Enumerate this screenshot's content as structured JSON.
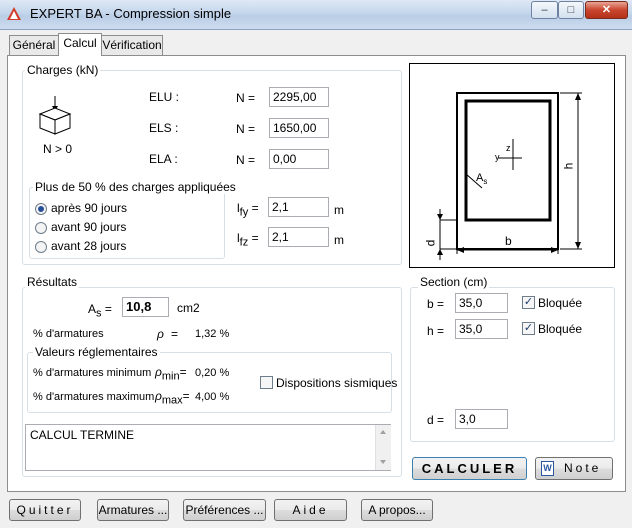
{
  "window": {
    "title": "EXPERT BA - Compression simple",
    "min": "–",
    "max": "□",
    "close": "✕"
  },
  "tabs": [
    {
      "label": "Général"
    },
    {
      "label": "Calcul"
    },
    {
      "label": "Vérification"
    }
  ],
  "charges": {
    "title": "Charges (kN)",
    "icon_caption": "N > 0",
    "rows": [
      {
        "state": "ELU :",
        "n_label": "N =",
        "value": "2295,00"
      },
      {
        "state": "ELS :",
        "n_label": "N =",
        "value": "1650,00"
      },
      {
        "state": "ELA :",
        "n_label": "N =",
        "value": "0,00"
      }
    ],
    "applied": {
      "title": "Plus de 50 % des charges appliquées",
      "options": [
        {
          "label": "après 90 jours",
          "selected": true
        },
        {
          "label": "avant 90 jours",
          "selected": false
        },
        {
          "label": "avant 28 jours",
          "selected": false
        }
      ]
    },
    "lfy": {
      "label": "l",
      "sub": "fy",
      "eq": "=",
      "value": "2,1",
      "unit": "m"
    },
    "lfz": {
      "label": "l",
      "sub": "fz",
      "eq": "=",
      "value": "2,1",
      "unit": "m"
    }
  },
  "diagram": {
    "label_b": "b",
    "label_h": "h",
    "label_d": "d",
    "label_as": "A",
    "label_as_sub": "s",
    "label_y": "y",
    "label_z": "z"
  },
  "results": {
    "title": "Résultats",
    "as_label": "A",
    "as_sub": "s",
    "as_eq": "=",
    "as_value": "10,8",
    "as_unit": "cm2",
    "pct_label": "% d'armatures",
    "rho_label": "ρ",
    "rho_eq": "=",
    "pct_value": "1,32 %",
    "regl": {
      "title": "Valeurs réglementaires",
      "min_label": "% d'armatures minimum",
      "min_rho": "ρ",
      "min_sub": "min",
      "min_eq": "=",
      "min_value": "0,20 %",
      "max_label": "% d'armatures maximum",
      "max_rho": "ρ",
      "max_sub": "max",
      "max_eq": "=",
      "max_value": "4,00 %",
      "seismic_label": "Dispositions sismiques",
      "seismic_checked": false
    },
    "message": "CALCUL TERMINE"
  },
  "section": {
    "title": "Section (cm)",
    "b": {
      "label": "b =",
      "value": "35,0",
      "locked_label": "Bloquée",
      "locked": true
    },
    "h": {
      "label": "h =",
      "value": "35,0",
      "locked_label": "Bloquée",
      "locked": true
    },
    "d": {
      "label": "d =",
      "value": "3,0"
    }
  },
  "buttons": {
    "calculer": "CALCULER",
    "note": "Note",
    "quitter": "Quitter",
    "armatures": "Armatures ...",
    "preferences": "Préférences ...",
    "aide": "Aide",
    "apropos": "A propos..."
  },
  "colors": {
    "title_bg": "#c4d6ec",
    "panel_bg": "#ffffff",
    "dialog_bg": "#f0f0f0",
    "radio_dot": "#254f97"
  }
}
